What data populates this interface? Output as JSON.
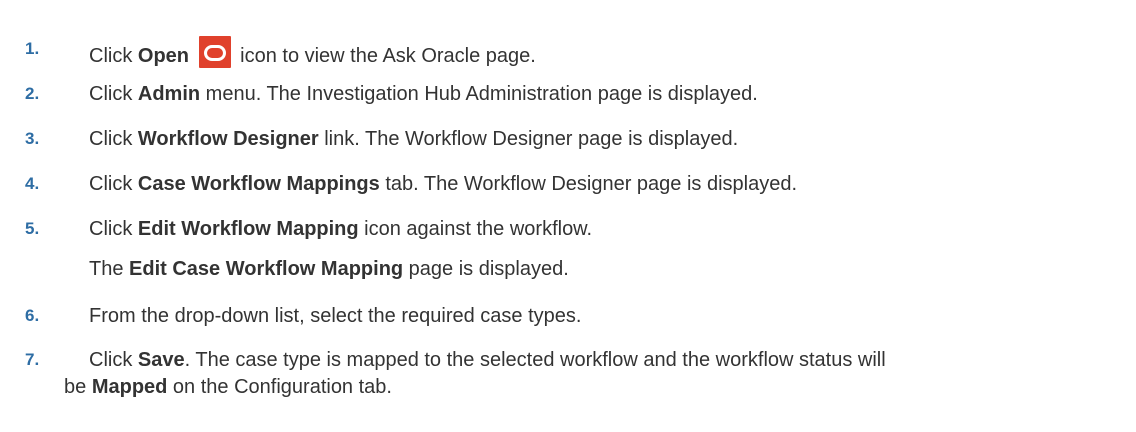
{
  "steps": [
    {
      "number": "1.",
      "pre": "Click ",
      "bold": "Open",
      "icon": "oracle-open-icon",
      "post": " icon to view the Ask Oracle page."
    },
    {
      "number": "2.",
      "pre": "Click ",
      "bold": "Admin",
      "post": " menu. The Investigation Hub Administration page is displayed."
    },
    {
      "number": "3.",
      "pre": "Click ",
      "bold": "Workflow Designer",
      "post": " link. The Workflow Designer page is displayed."
    },
    {
      "number": "4.",
      "pre": "Click ",
      "bold": "Case Workflow Mappings",
      "post": " tab. The Workflow Designer page is displayed."
    },
    {
      "number": "5.",
      "pre": "Click ",
      "bold": "Edit Workflow Mapping",
      "post": " icon against the workflow.",
      "sub_pre": "The ",
      "sub_bold": "Edit Case Workflow Mapping",
      "sub_post": " page is displayed."
    },
    {
      "number": "6.",
      "text": "From the drop-down list, select the required case types."
    },
    {
      "number": "7.",
      "pre": "Click ",
      "bold": "Save",
      "post": ". The case type is mapped to the selected workflow and the workflow status will",
      "line2_pre": "be ",
      "line2_bold": "Mapped",
      "line2_post": " on the Configuration tab."
    }
  ],
  "colors": {
    "step_number": "#2e6da4",
    "text": "#333333",
    "icon_bg": "#e0412c"
  }
}
